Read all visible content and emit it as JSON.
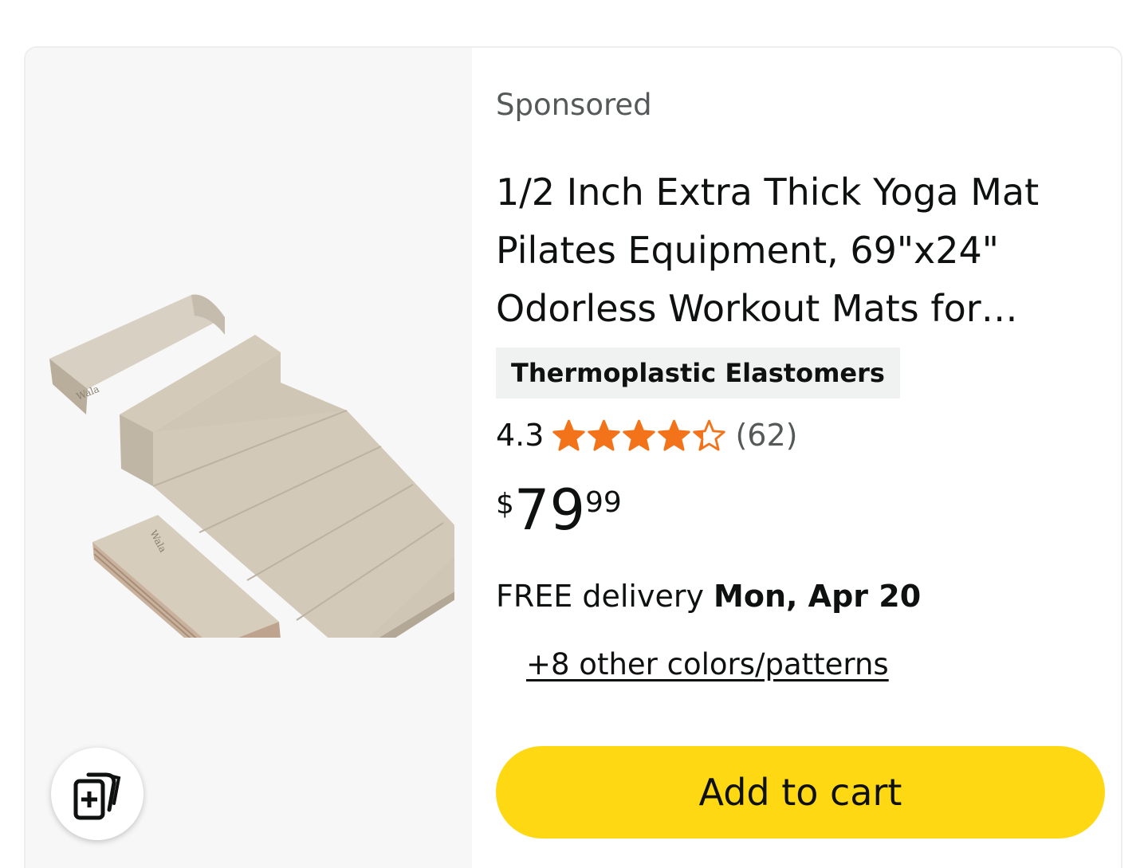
{
  "product": {
    "sponsored_label": "Sponsored",
    "title": "1/2 Inch Extra Thick Yoga Mat Pilates Equipment, 69\"x24\" Odorless Workout Mats for…",
    "material": "Thermoplastic Elastomers",
    "rating": "4.3",
    "rating_stars": 4.3,
    "rating_count": "(62)",
    "price": {
      "symbol": "$",
      "whole": "79",
      "fraction": "99"
    },
    "delivery": {
      "prefix": "FREE delivery ",
      "date": "Mon, Apr 20"
    },
    "other_colors": "+8 other colors/patterns",
    "add_to_cart": "Add to cart"
  },
  "icons": {
    "compare": "compare-cards-icon",
    "star": "star-icon"
  },
  "colors": {
    "star": "#f3731b",
    "cart_button": "#ffd814",
    "image_bg": "#f7f7f7",
    "mat": "#cfc6b6"
  }
}
